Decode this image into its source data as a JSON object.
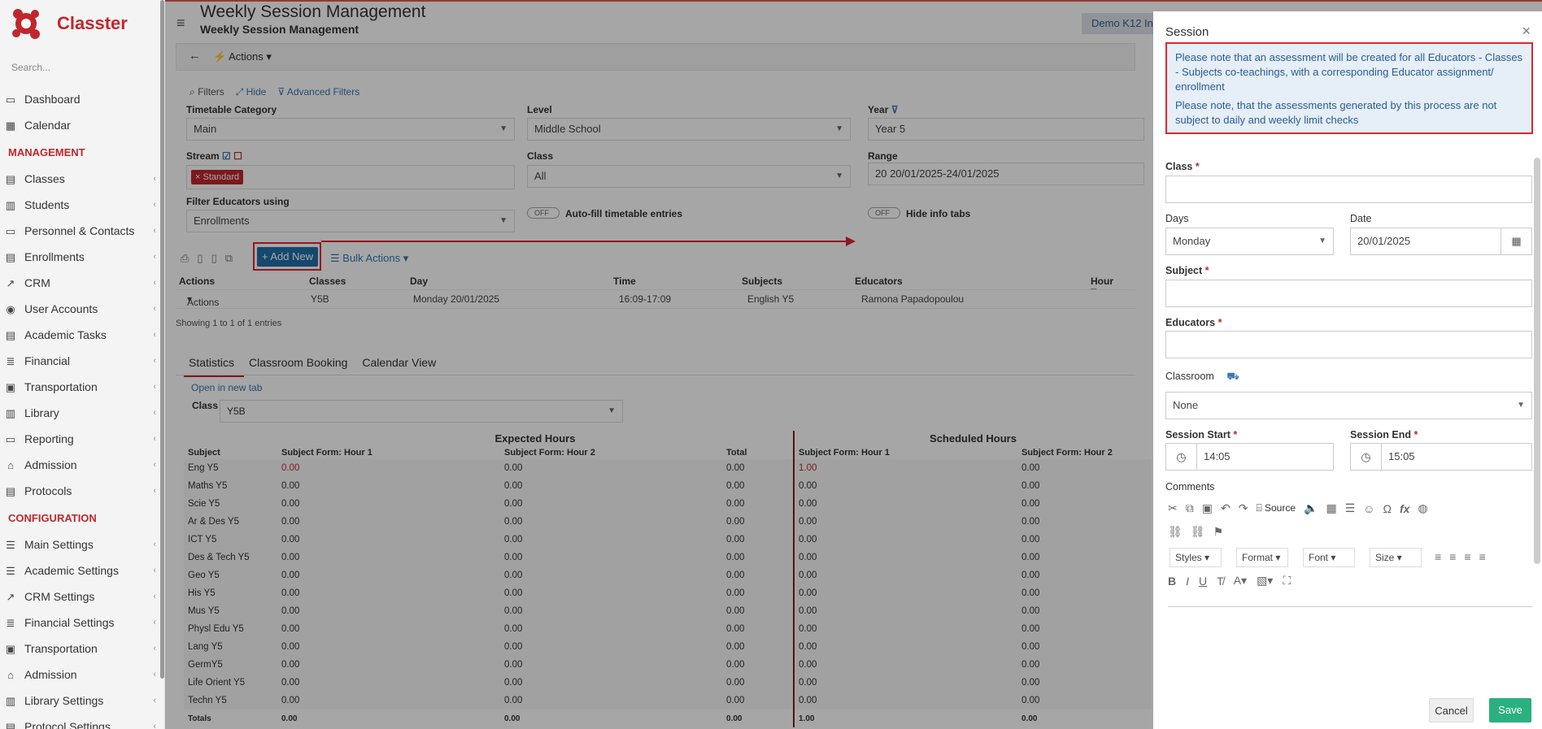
{
  "app": {
    "name": "Classter",
    "search_placeholder": "Search..."
  },
  "sidebar": {
    "items_top": [
      {
        "label": "Dashboard",
        "icon": "monitor-icon"
      },
      {
        "label": "Calendar",
        "icon": "calendar-icon"
      }
    ],
    "management_title": "MANAGEMENT",
    "management": [
      {
        "label": "Classes"
      },
      {
        "label": "Students"
      },
      {
        "label": "Personnel & Contacts"
      },
      {
        "label": "Enrollments"
      },
      {
        "label": "CRM"
      },
      {
        "label": "User Accounts"
      },
      {
        "label": "Academic Tasks"
      },
      {
        "label": "Financial"
      },
      {
        "label": "Transportation"
      },
      {
        "label": "Library"
      },
      {
        "label": "Reporting"
      },
      {
        "label": "Admission"
      },
      {
        "label": "Protocols"
      }
    ],
    "configuration_title": "CONFIGURATION",
    "configuration": [
      {
        "label": "Main Settings"
      },
      {
        "label": "Academic Settings"
      },
      {
        "label": "CRM Settings"
      },
      {
        "label": "Financial Settings"
      },
      {
        "label": "Transportation"
      },
      {
        "label": "Admission"
      },
      {
        "label": "Library Settings"
      },
      {
        "label": "Protocol Settings"
      }
    ]
  },
  "header": {
    "title": "Weekly Session Management",
    "subtitle": "Weekly Session Management",
    "tenant": "Demo K12 In"
  },
  "toolbar": {
    "actions": "Actions"
  },
  "filters": {
    "filters_label": "Filters",
    "hide_label": "Hide",
    "advanced_label": "Advanced Filters",
    "timetable_category_label": "Timetable Category",
    "timetable_category": "Main",
    "level_label": "Level",
    "level": "Middle School",
    "year_label": "Year",
    "year": "Year 5",
    "stream_label": "Stream",
    "stream_tag": "Standard",
    "class_label": "Class",
    "class": "All",
    "range_label": "Range",
    "range": "20 20/01/2025-24/01/2025",
    "filter_educators_label": "Filter Educators using",
    "filter_educators": "Enrollments",
    "toggle_off": "OFF",
    "autofill_label": "Auto-fill timetable entries",
    "hide_info_label": "Hide info tabs"
  },
  "grid": {
    "add_new": "Add New",
    "bulk_actions": "Bulk Actions",
    "columns": [
      "Actions",
      "Classes",
      "Day",
      "Time",
      "Subjects",
      "Educators",
      "Hour Type"
    ],
    "row": {
      "actions": "Actions",
      "classes": "Y5B",
      "day": "Monday 20/01/2025",
      "time": "16:09-17:09",
      "subjects": "English Y5",
      "educators": "Ramona Papadopoulou"
    },
    "showing": "Showing 1 to 1 of 1 entries"
  },
  "tabs": [
    "Statistics",
    "Classroom Booking",
    "Calendar View"
  ],
  "stats": {
    "open_new_tab": "Open in new tab",
    "class_label": "Class",
    "class_value": "Y5B",
    "expected_header": "Expected Hours",
    "scheduled_header": "Scheduled Hours",
    "columns": [
      "Subject",
      "Subject Form: Hour 1",
      "Subject Form: Hour 2",
      "Total",
      "Subject Form: Hour 1",
      "Subject Form: Hour 2"
    ],
    "rows": [
      [
        "Eng Y5",
        "0.00",
        "0.00",
        "0.00",
        "1.00",
        "0.00"
      ],
      [
        "Maths Y5",
        "0.00",
        "0.00",
        "0.00",
        "0.00",
        "0.00"
      ],
      [
        "Scie Y5",
        "0.00",
        "0.00",
        "0.00",
        "0.00",
        "0.00"
      ],
      [
        "Ar & Des Y5",
        "0.00",
        "0.00",
        "0.00",
        "0.00",
        "0.00"
      ],
      [
        "ICT Y5",
        "0.00",
        "0.00",
        "0.00",
        "0.00",
        "0.00"
      ],
      [
        "Des & Tech Y5",
        "0.00",
        "0.00",
        "0.00",
        "0.00",
        "0.00"
      ],
      [
        "Geo Y5",
        "0.00",
        "0.00",
        "0.00",
        "0.00",
        "0.00"
      ],
      [
        "His Y5",
        "0.00",
        "0.00",
        "0.00",
        "0.00",
        "0.00"
      ],
      [
        "Mus Y5",
        "0.00",
        "0.00",
        "0.00",
        "0.00",
        "0.00"
      ],
      [
        "Physl Edu Y5",
        "0.00",
        "0.00",
        "0.00",
        "0.00",
        "0.00"
      ],
      [
        "Lang Y5",
        "0.00",
        "0.00",
        "0.00",
        "0.00",
        "0.00"
      ],
      [
        "GermY5",
        "0.00",
        "0.00",
        "0.00",
        "0.00",
        "0.00"
      ],
      [
        "Life Orient Y5",
        "0.00",
        "0.00",
        "0.00",
        "0.00",
        "0.00"
      ],
      [
        "Techn Y5",
        "0.00",
        "0.00",
        "0.00",
        "0.00",
        "0.00"
      ]
    ],
    "totals": [
      "Totals",
      "0.00",
      "0.00",
      "0.00",
      "1.00",
      "0.00"
    ]
  },
  "modal": {
    "title": "Session",
    "notice_1": "Please note that an assessment will be created for all Educators - Classes - Subjects co-teachings, with a corresponding Educator assignment/ enrollment",
    "notice_2": "Please note, that the assessments generated by this process are not subject to daily and weekly limit checks",
    "class_label": "Class",
    "class_value": "",
    "days_label": "Days",
    "days_value": "Monday",
    "date_label": "Date",
    "date_value": "20/01/2025",
    "subject_label": "Subject",
    "subject_value": "",
    "educators_label": "Educators",
    "educators_value": "",
    "classroom_label": "Classroom",
    "classroom_value": "None",
    "session_start_label": "Session Start",
    "session_start": "14:05",
    "session_end_label": "Session End",
    "session_end": "15:05",
    "comments_label": "Comments",
    "editor": {
      "source": "Source",
      "styles": "Styles",
      "format": "Format",
      "font": "Font",
      "size": "Size"
    },
    "cancel": "Cancel",
    "save": "Save",
    "required_mark": "*"
  },
  "colors": {
    "brand": "#c0272d",
    "primary": "#1f6fa8",
    "save": "#2bb07f",
    "highlight": "#e0262e"
  }
}
